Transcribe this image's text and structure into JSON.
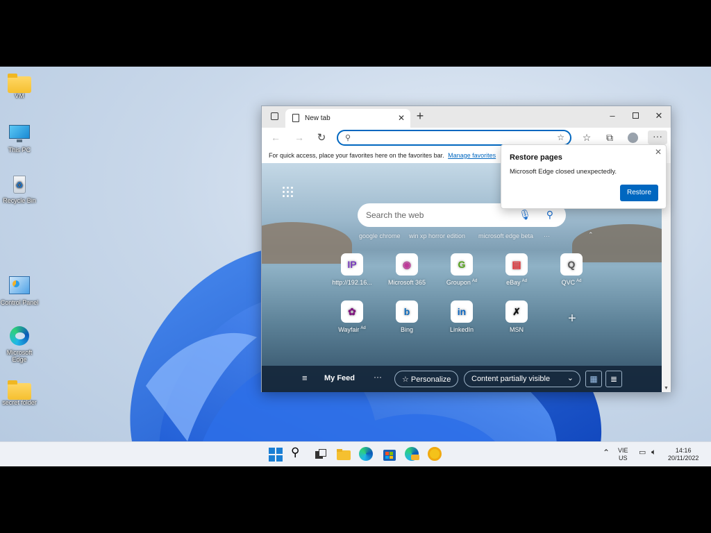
{
  "desktop": {
    "icons": [
      {
        "label": "VM",
        "icon": "folder-icon"
      },
      {
        "label": "This PC",
        "icon": "monitor-icon"
      },
      {
        "label": "Recycle Bin",
        "icon": "recycle-bin-icon"
      },
      {
        "label": "Control Panel",
        "icon": "control-panel-icon"
      },
      {
        "label": "Microsoft Edge",
        "icon": "edge-icon"
      },
      {
        "label": "secret folder",
        "icon": "folder-icon"
      }
    ]
  },
  "browser": {
    "tab_title": "New tab",
    "favbar_text": "For quick access, place your favorites here on the favorites bar.",
    "favbar_link": "Manage favorites",
    "search_placeholder": "Search the web",
    "suggestions": [
      "google chrome",
      "win xp horror edition",
      "microsoft edge beta"
    ],
    "tiles_row1": [
      {
        "label": "http://192.16...",
        "glyph": "IP",
        "color": "#7a3dbf",
        "ad": ""
      },
      {
        "label": "Microsoft 365",
        "glyph": "◉",
        "color": "#c0399a",
        "ad": ""
      },
      {
        "label": "Groupon",
        "glyph": "G",
        "color": "#53a318",
        "ad": "Ad"
      },
      {
        "label": "eBay",
        "glyph": "▤",
        "color": "#e53238",
        "ad": "Ad"
      },
      {
        "label": "QVC",
        "glyph": "Q",
        "color": "#555555",
        "ad": "Ad"
      }
    ],
    "tiles_row2": [
      {
        "label": "Wayfair",
        "glyph": "✿",
        "color": "#7f187f",
        "ad": "Ad"
      },
      {
        "label": "Bing",
        "glyph": "b",
        "color": "#0f6cbd",
        "ad": ""
      },
      {
        "label": "LinkedIn",
        "glyph": "in",
        "color": "#0a66c2",
        "ad": ""
      },
      {
        "label": "MSN",
        "glyph": "✗",
        "color": "#111111",
        "ad": ""
      }
    ],
    "add_tile": "+",
    "feed": {
      "my_feed": "My Feed",
      "personalize": "Personalize",
      "content_visibility": "Content partially visible"
    }
  },
  "restore_popup": {
    "title": "Restore pages",
    "message": "Microsoft Edge closed unexpectedly.",
    "button": "Restore"
  },
  "taskbar": {
    "lang_top": "VIE",
    "lang_bottom": "US",
    "time": "14:16",
    "date": "20/11/2022"
  },
  "colors": {
    "accent": "#0067c0",
    "folder": "#f5c030"
  }
}
